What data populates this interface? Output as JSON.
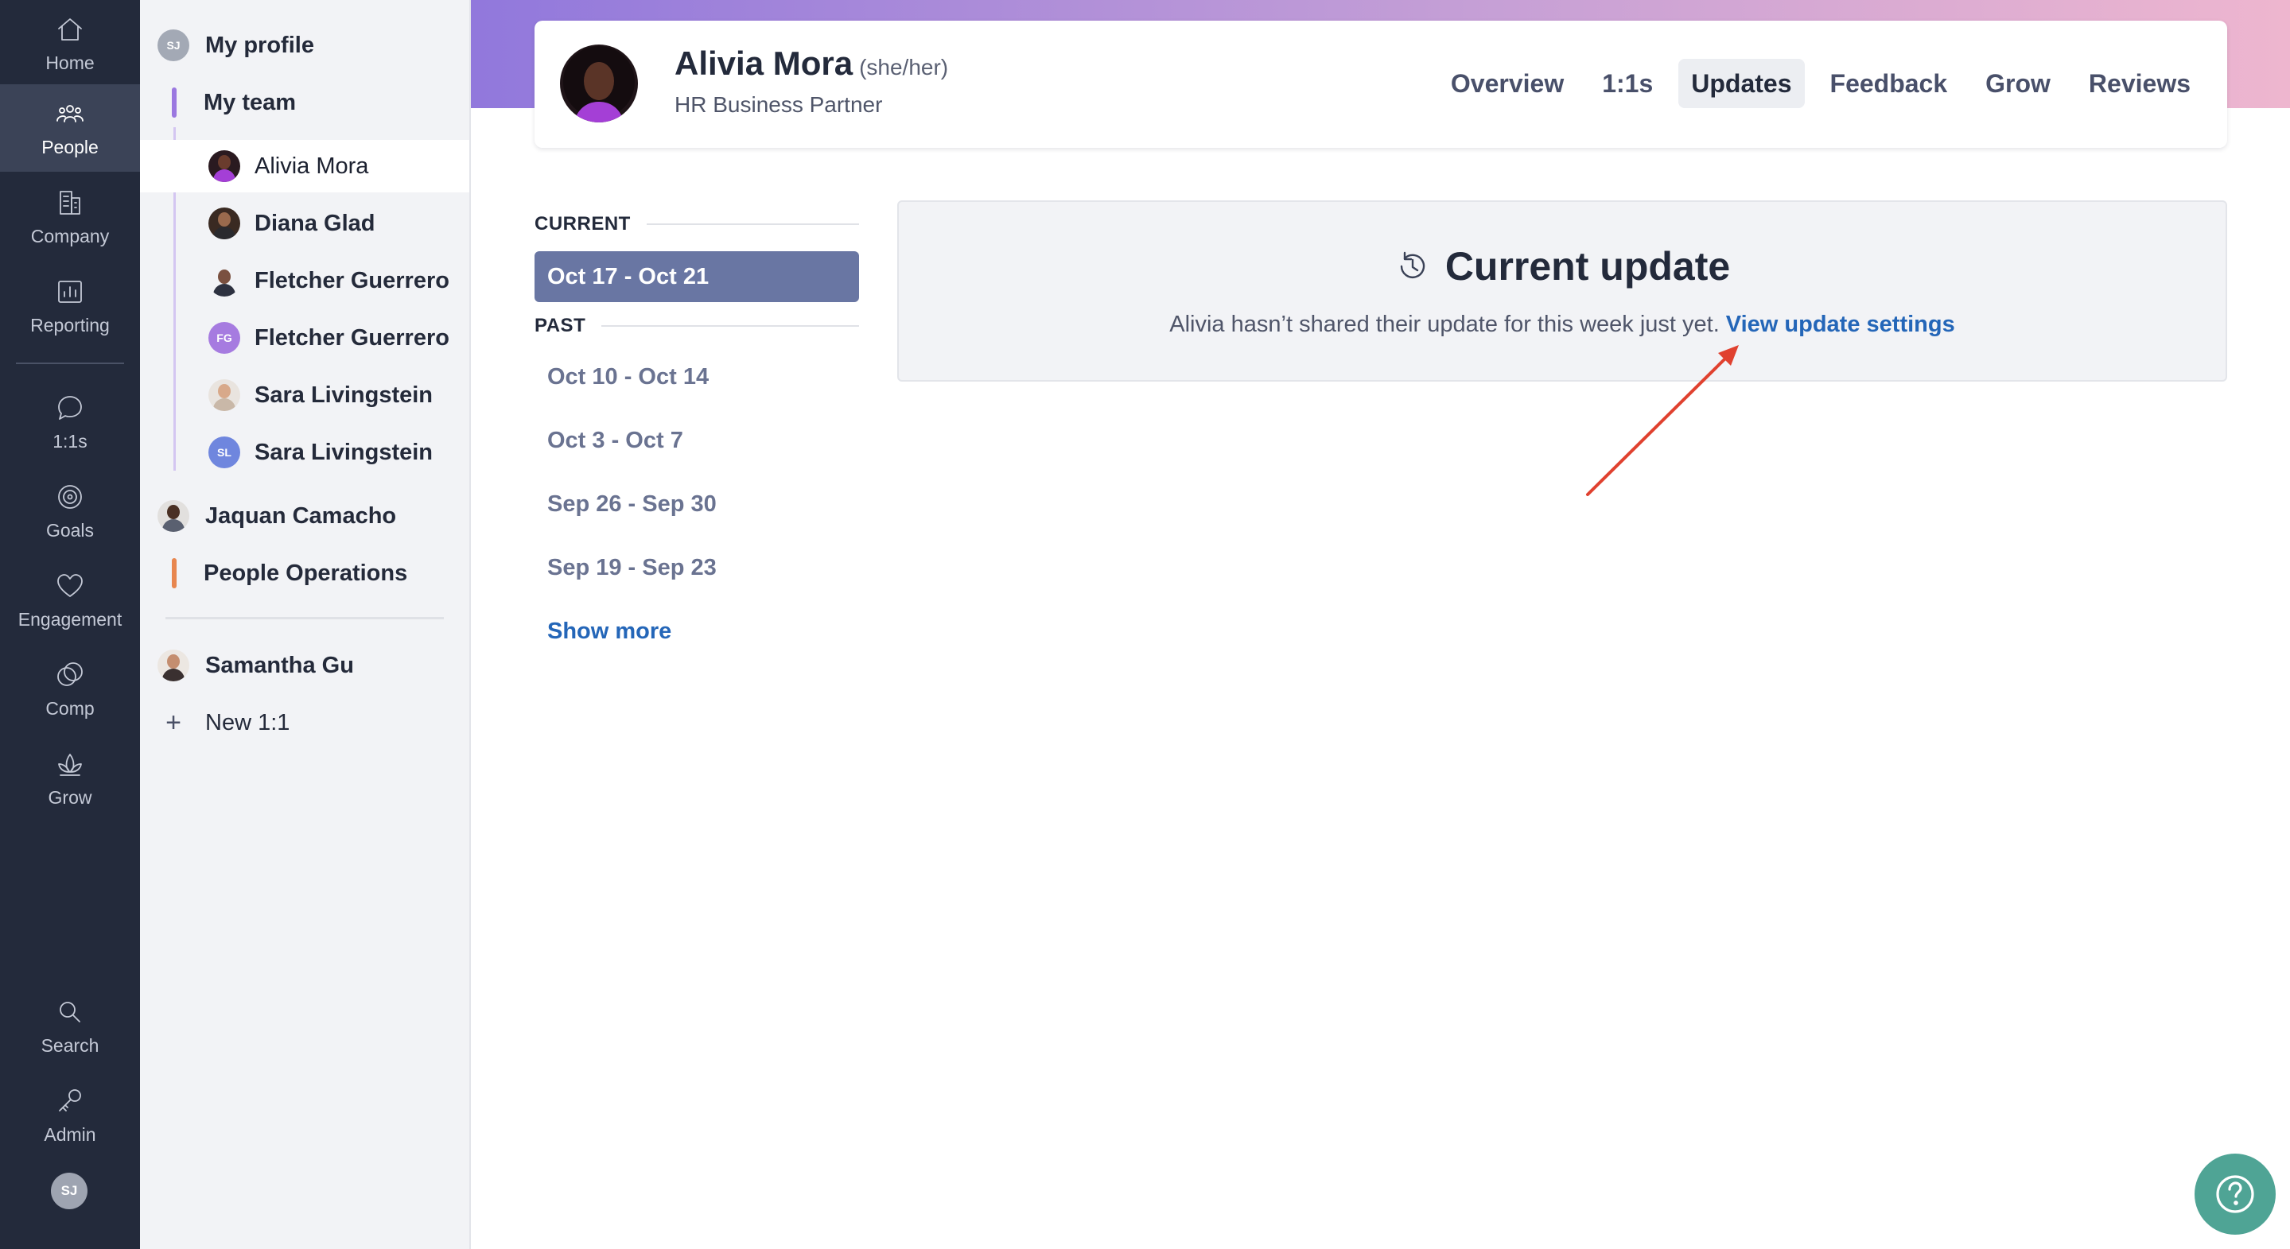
{
  "nav": {
    "items": [
      {
        "label": "Home",
        "icon": "home-icon"
      },
      {
        "label": "People",
        "icon": "people-icon",
        "active": true
      },
      {
        "label": "Company",
        "icon": "company-icon"
      },
      {
        "label": "Reporting",
        "icon": "reporting-icon"
      },
      {
        "label": "1:1s",
        "icon": "chat-icon"
      },
      {
        "label": "Goals",
        "icon": "target-icon"
      },
      {
        "label": "Engagement",
        "icon": "heart-icon"
      },
      {
        "label": "Comp",
        "icon": "coins-icon"
      },
      {
        "label": "Grow",
        "icon": "lotus-icon"
      }
    ],
    "bottom": [
      {
        "label": "Search",
        "icon": "search-icon"
      },
      {
        "label": "Admin",
        "icon": "key-icon"
      }
    ],
    "user_initials": "SJ"
  },
  "sidebar": {
    "my_profile": {
      "label": "My profile",
      "initials": "SJ"
    },
    "my_team": {
      "label": "My team",
      "bar_color": "#9b78e0"
    },
    "team": [
      {
        "name": "Alivia Mora",
        "selected": true
      },
      {
        "name": "Diana Glad"
      },
      {
        "name": "Fletcher Guerrero"
      },
      {
        "name": "Fletcher Guerrero",
        "initials": "FG",
        "color": "#a67be0"
      },
      {
        "name": "Sara Livingstein"
      },
      {
        "name": "Sara Livingstein",
        "initials": "SL",
        "color": "#6f86de"
      }
    ],
    "manager": {
      "name": "Jaquan Camacho"
    },
    "group": {
      "label": "People Operations",
      "bar_color": "#e8864f"
    },
    "other": {
      "name": "Samantha Gu"
    },
    "new_label": "New 1:1"
  },
  "profile": {
    "name": "Alivia Mora",
    "pronouns": "(she/her)",
    "role": "HR Business Partner",
    "tabs": [
      "Overview",
      "1:1s",
      "Updates",
      "Feedback",
      "Grow",
      "Reviews"
    ],
    "active_tab": "Updates"
  },
  "periods": {
    "current_label": "CURRENT",
    "current": "Oct 17 - Oct 21",
    "past_label": "PAST",
    "past": [
      "Oct 10 - Oct 14",
      "Oct 3 - Oct 7",
      "Sep 26 - Sep 30",
      "Sep 19 - Sep 23"
    ],
    "show_more": "Show more"
  },
  "update": {
    "title": "Current update",
    "message": "Alivia hasn’t shared their update for this week just yet.",
    "link": "View update settings"
  },
  "colors": {
    "rail_bg": "#232a3b",
    "accent_link": "#2466b8",
    "selected_period": "#6976a3",
    "help_button": "#4fa495",
    "annotation_arrow": "#e0412f"
  }
}
